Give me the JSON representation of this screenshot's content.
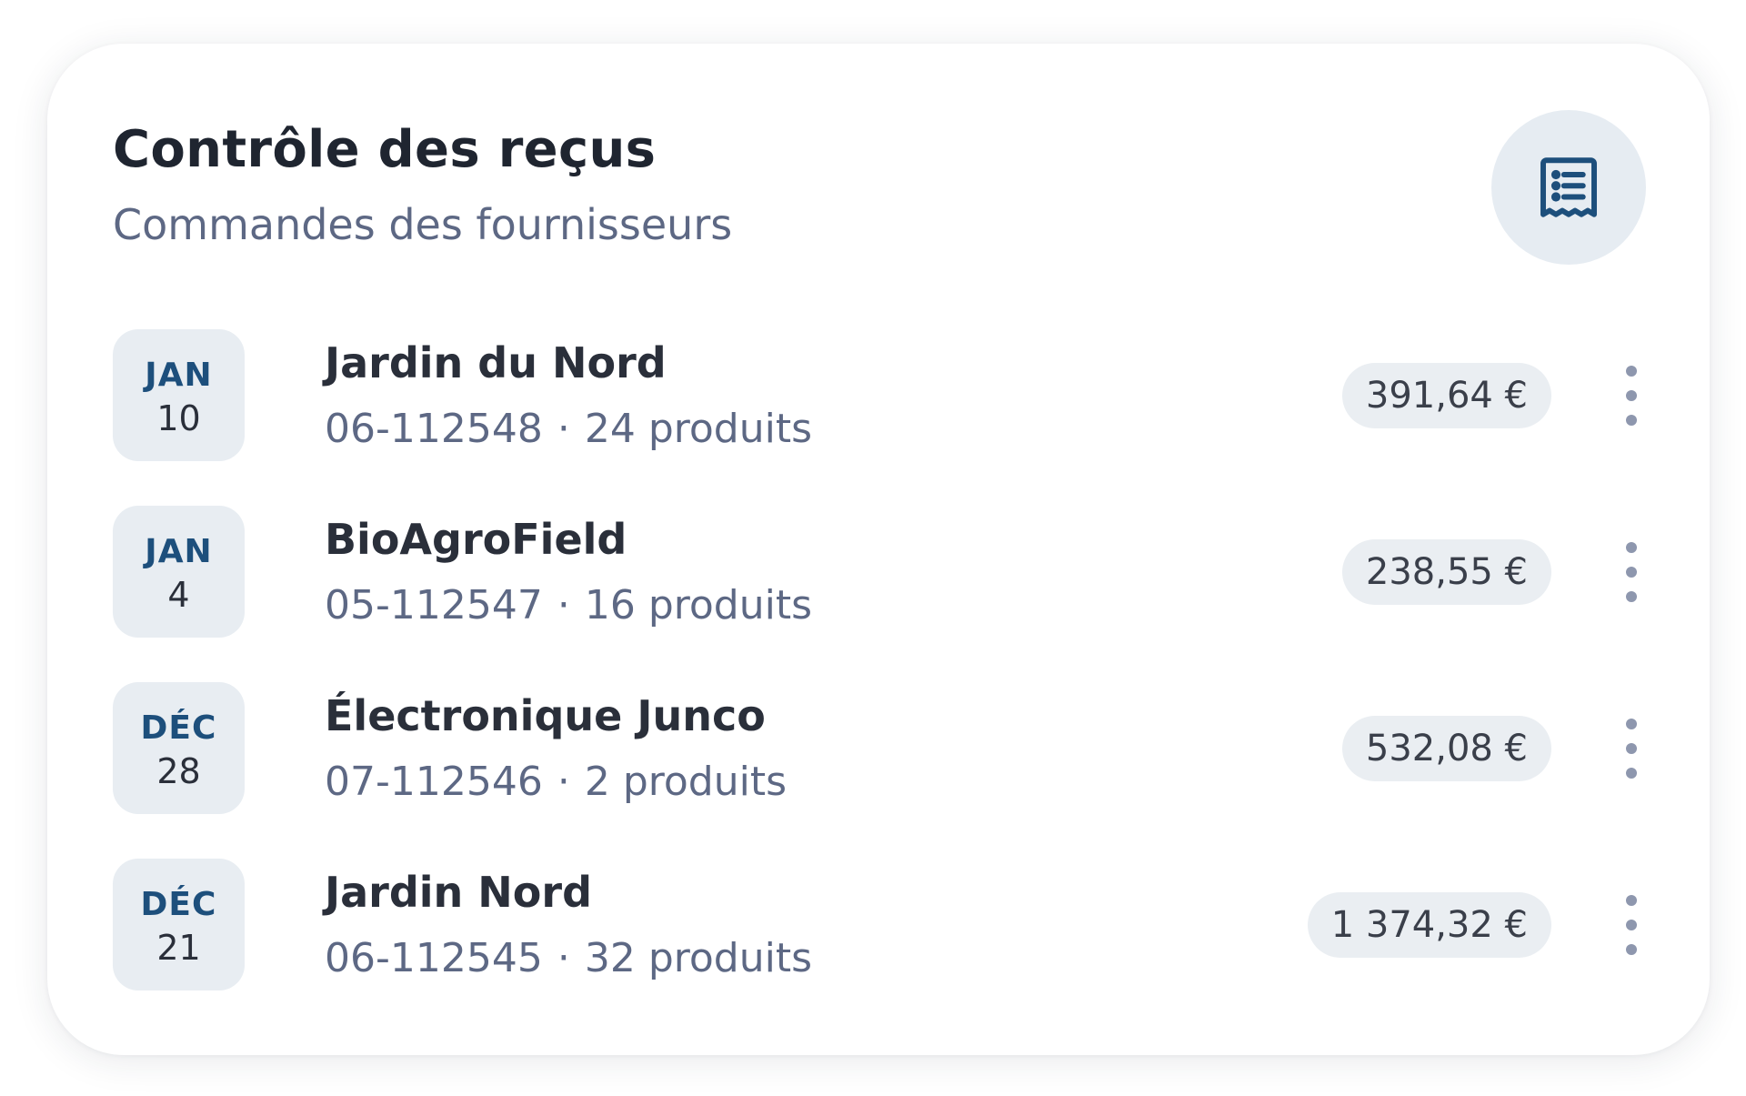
{
  "header": {
    "title": "Contrôle des reçus",
    "subtitle": "Commandes des fournisseurs",
    "icon": "receipt-list-icon"
  },
  "receipts": [
    {
      "month": "JAN",
      "day": "10",
      "supplier": "Jardin du Nord",
      "order": "06-112548",
      "separator": "·",
      "products": "24 produits",
      "amount": "391,64 €"
    },
    {
      "month": "JAN",
      "day": "4",
      "supplier": "BioAgroField",
      "order": "05-112547",
      "separator": "·",
      "products": "16 produits",
      "amount": "238,55 €"
    },
    {
      "month": "DÉC",
      "day": "28",
      "supplier": "Électronique Junco",
      "order": "07-112546",
      "separator": "·",
      "products": "2 produits",
      "amount": "532,08 €"
    },
    {
      "month": "DÉC",
      "day": "21",
      "supplier": "Jardin Nord",
      "order": "06-112545",
      "separator": "·",
      "products": "32 produits",
      "amount": "1 374,32 €"
    }
  ],
  "colors": {
    "accent": "#1d4f7c",
    "muted_text": "#5d6884",
    "chip_bg": "#e8edf2"
  },
  "icons": {
    "more": "more-vertical-icon"
  }
}
